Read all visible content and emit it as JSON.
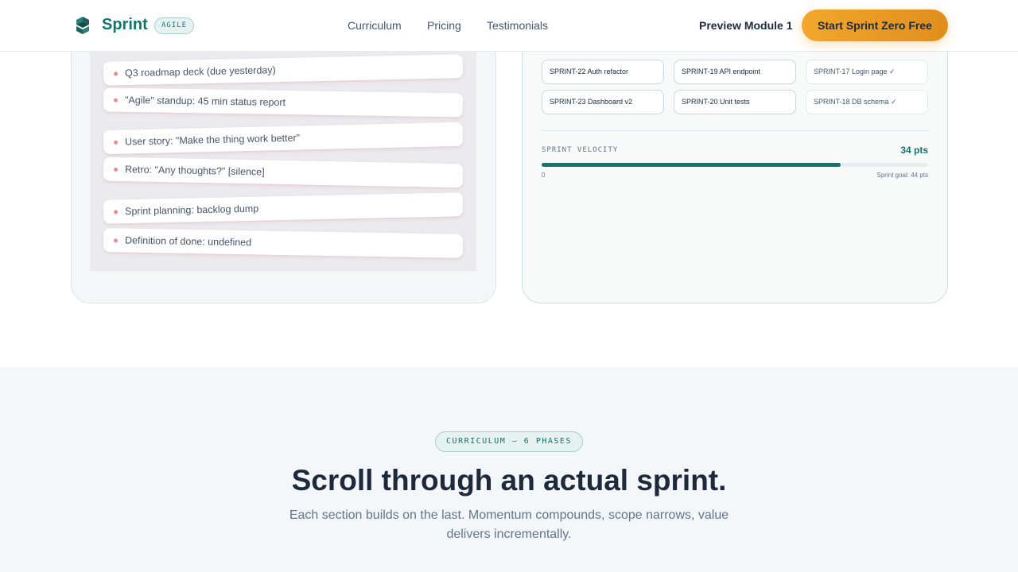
{
  "header": {
    "brand": "Sprint",
    "badge": "AGILE",
    "nav": [
      "Curriculum",
      "Pricing",
      "Testimonials"
    ],
    "preview": "Preview Module 1",
    "cta": "Start Sprint Zero Free"
  },
  "chaos": {
    "items": [
      "Q3 roadmap deck (due yesterday)",
      "\"Agile\" standup: 45 min status report",
      "User story: \"Make the thing work better\"",
      "Retro: \"Any thoughts?\" [silence]",
      "Sprint planning: backlog dump",
      "Definition of done: undefined"
    ]
  },
  "board": {
    "tickets": [
      "SPRINT-22 Auth refactor",
      "SPRINT-19 API endpoint",
      "SPRINT-17 Login page ✓",
      "SPRINT-23 Dashboard v2",
      "SPRINT-20 Unit tests",
      "SPRINT-18 DB schema ✓"
    ],
    "velocity_label": "SPRINT VELOCITY",
    "velocity_value": "34 pts",
    "velocity_points": 34,
    "velocity_goal_points": 44,
    "bar_min": "0",
    "bar_goal": "Sprint goal: 44 pts"
  },
  "curriculum": {
    "pill": "CURRICULUM — 6 PHASES",
    "headline": "Scroll through an actual sprint.",
    "sub": "Each section builds on the last. Momentum compounds, scope narrows, value delivers incrementally."
  },
  "colors": {
    "brand": "#0f766e",
    "cta": "#f2a72c",
    "text": "#1e293b",
    "muted": "#64748b"
  }
}
